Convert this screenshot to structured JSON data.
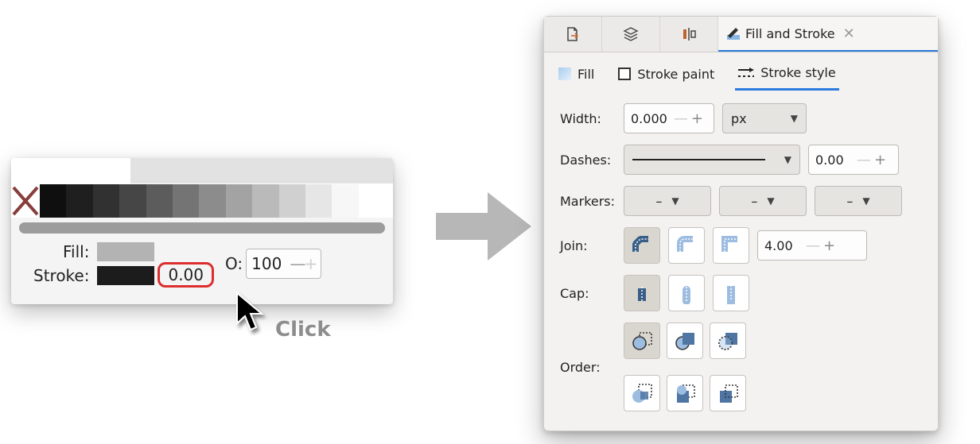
{
  "palette": {
    "fill_label": "Fill:",
    "stroke_label": "Stroke:",
    "stroke_value": "0.00",
    "opacity_label": "O:",
    "opacity_value": "100",
    "fill_swatch_color": "#b3b3b3",
    "stroke_swatch_color": "#1c1c1c",
    "grayscale_swatches": [
      "#0f0f0f",
      "#1f1f1f",
      "#313131",
      "#464646",
      "#5c5c5c",
      "#747474",
      "#8c8c8c",
      "#a3a3a3",
      "#bababa",
      "#d0d0d0",
      "#e6e6e6",
      "#f7f7f7",
      "#ffffff"
    ]
  },
  "annotation": {
    "click": "Click"
  },
  "dialog": {
    "title": "Fill and Stroke",
    "tabs": {
      "fill": "Fill",
      "stroke_paint": "Stroke paint",
      "stroke_style": "Stroke style"
    },
    "width_label": "Width:",
    "width_value": "0.000",
    "width_unit": "px",
    "dashes_label": "Dashes:",
    "dashes_offset": "0.00",
    "markers_label": "Markers:",
    "join_label": "Join:",
    "miter_limit": "4.00",
    "cap_label": "Cap:",
    "order_label": "Order:"
  }
}
